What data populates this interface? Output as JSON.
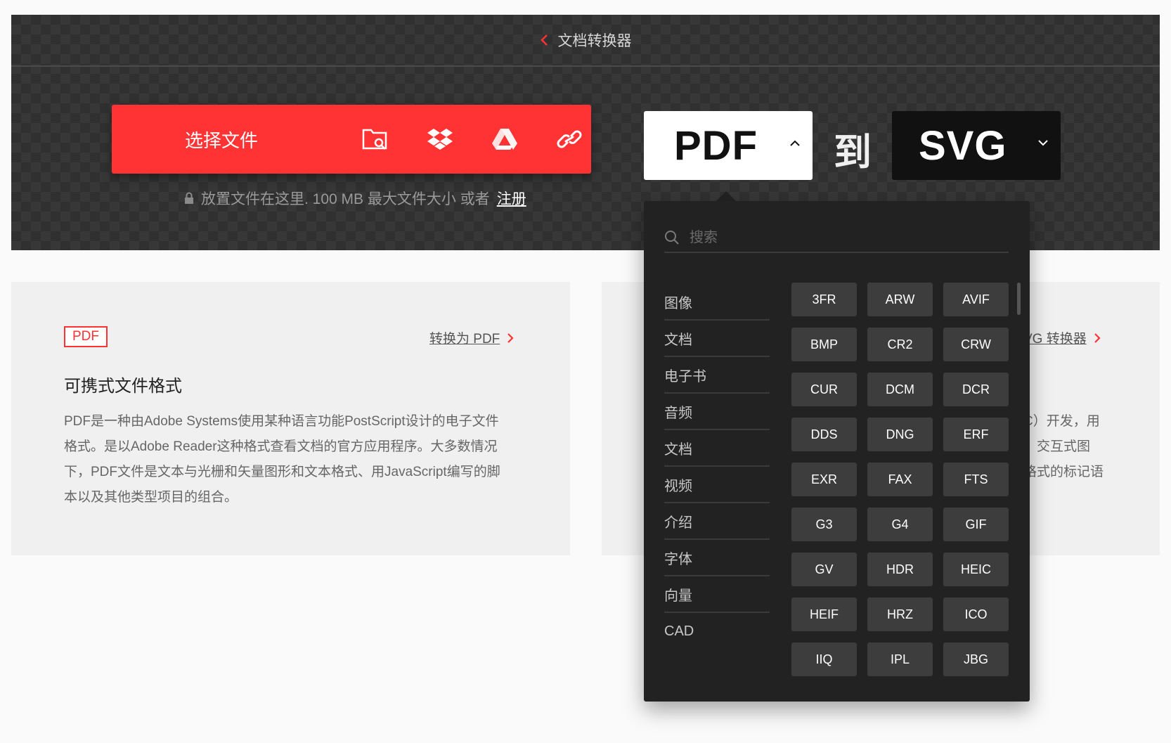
{
  "hero": {
    "title": "文档转换器",
    "choose_label": "选择文件",
    "drop_note": "放置文件在这里. 100 MB 最大文件大小 或者",
    "signup": "注册",
    "from_format": "PDF",
    "to_word": "到",
    "to_format": "SVG"
  },
  "left_card": {
    "badge": "PDF",
    "link": "转换为 PDF",
    "title": "可携式文件格式",
    "desc_lines": [
      "PDF是一种由Adobe Systems使用某种语言功能PostScript设计的电子文件",
      "格式。是以Adobe Reader这种格式查看文档的官方应用程序。大多数情况",
      "下，PDF文件是文本与光栅和矢量图形和文本格式、用JavaScript编写的脚",
      "本以及其他类型项目的组合。"
    ]
  },
  "right_card": {
    "link": "VG 转换器",
    "desc_lines": [
      "C）开发，用",
      "、交互式图",
      "格式的标记语"
    ]
  },
  "dropdown": {
    "search_placeholder": "搜索",
    "categories": [
      "图像",
      "文档",
      "电子书",
      "音频",
      "文档",
      "视频",
      "介绍",
      "字体",
      "向量",
      "CAD"
    ],
    "formats": [
      "3FR",
      "ARW",
      "AVIF",
      "BMP",
      "CR2",
      "CRW",
      "CUR",
      "DCM",
      "DCR",
      "DDS",
      "DNG",
      "ERF",
      "EXR",
      "FAX",
      "FTS",
      "G3",
      "G4",
      "GIF",
      "GV",
      "HDR",
      "HEIC",
      "HEIF",
      "HRZ",
      "ICO",
      "IIQ",
      "IPL",
      "JBG"
    ]
  },
  "colors": {
    "accent": "#ff3333",
    "hero_bg": "#303030",
    "dropdown_bg": "#222222",
    "format_button": "#3d3d3d"
  }
}
